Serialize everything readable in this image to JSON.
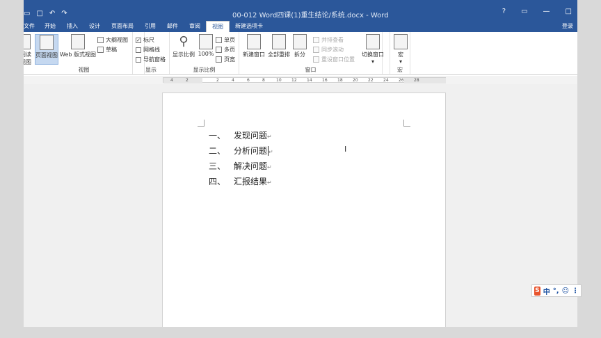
{
  "window": {
    "title": "00-012 Word四课(1)重生结论/系统.docx - Word",
    "qat": [
      "▭",
      "□",
      "↶",
      "↷"
    ],
    "controls": [
      "?",
      "▭",
      "—",
      "□"
    ]
  },
  "tabs": [
    "文件",
    "开始",
    "插入",
    "设计",
    "页面布局",
    "引用",
    "邮件",
    "审阅",
    "视图",
    "新建选项卡"
  ],
  "active_tab": "视图",
  "login": "登录",
  "ribbon": {
    "views": {
      "label": "视图",
      "read_mode_line1": "阅读",
      "read_mode_line2": "视图",
      "print_layout": "页面视图",
      "web_layout": "Web 版式视图",
      "outline": "大纲视图",
      "draft": "草稿"
    },
    "show": {
      "label": "显示",
      "ruler": "标尺",
      "gridlines": "网格线",
      "nav_pane": "导航窗格",
      "ruler_checked": "✓"
    },
    "zoom": {
      "label": "显示比例",
      "zoom": "显示比例",
      "hundred": "100%",
      "one_page": "单页",
      "multi_page": "多页",
      "page_width": "页宽"
    },
    "window": {
      "label": "窗口",
      "new_window": "新建窗口",
      "arrange_all": "全部重排",
      "split": "拆分",
      "side_by_side": "并排查看",
      "sync_scroll": "同步滚动",
      "reset_pos": "重设窗口位置",
      "switch": "切换窗口",
      "switch_arrow": "▾"
    },
    "macros": {
      "label": "宏",
      "macro": "宏",
      "macro_arrow": "▾"
    }
  },
  "ruler_ticks": [
    "4",
    "2",
    "",
    "2",
    "4",
    "6",
    "8",
    "10",
    "12",
    "14",
    "16",
    "18",
    "20",
    "22",
    "24",
    "26",
    "28"
  ],
  "document": {
    "items": [
      {
        "num": "一、",
        "text": "发现问题"
      },
      {
        "num": "二、",
        "text": "分析问题"
      },
      {
        "num": "三、",
        "text": "解决问题"
      },
      {
        "num": "四、",
        "text": "汇报结果"
      }
    ],
    "para_mark": "↵"
  },
  "ime": {
    "logo": "S",
    "lang": "中",
    "punct": "°,",
    "emoji": "☺",
    "more": "⋮"
  }
}
